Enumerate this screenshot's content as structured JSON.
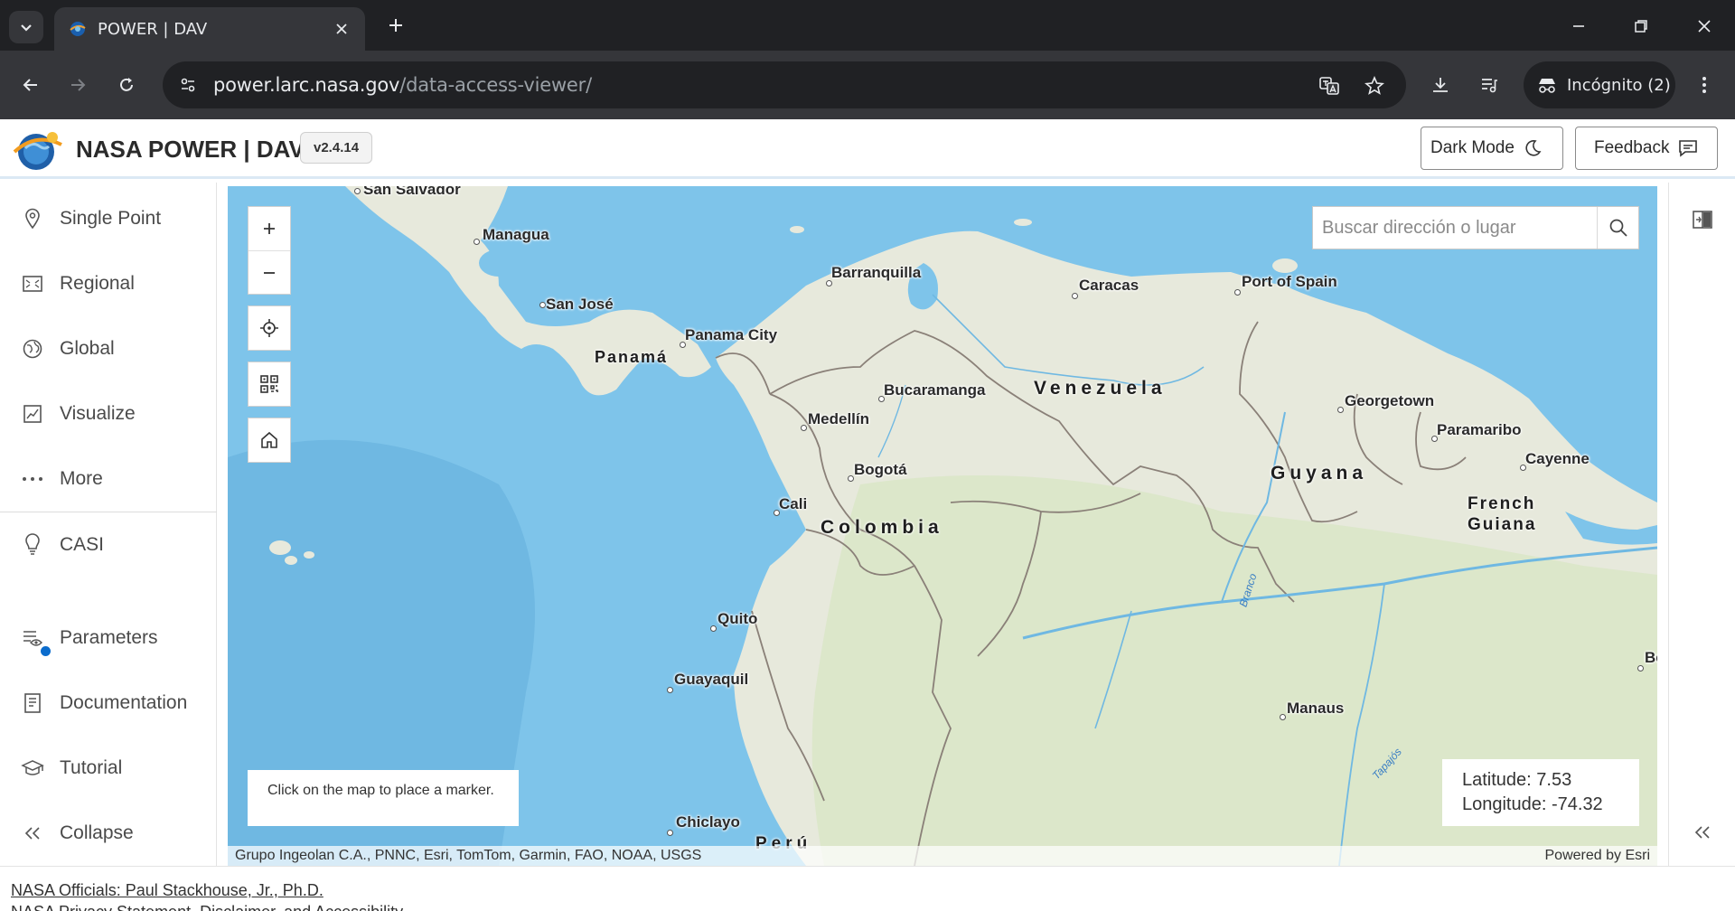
{
  "browser": {
    "tab_title": "POWER | DAV",
    "url_host": "power.larc.nasa.gov",
    "url_path": "/data-access-viewer/",
    "incognito_label": "Incógnito (2)"
  },
  "header": {
    "title": "NASA POWER | DAV",
    "version": "v2.4.14",
    "dark_mode_label": "Dark Mode",
    "feedback_label": "Feedback"
  },
  "sidebar": {
    "items": [
      {
        "label": "Single Point",
        "icon": "map-pin-icon"
      },
      {
        "label": "Regional",
        "icon": "region-icon"
      },
      {
        "label": "Global",
        "icon": "globe-icon"
      },
      {
        "label": "Visualize",
        "icon": "chart-icon"
      },
      {
        "label": "More",
        "icon": "ellipsis-icon"
      },
      {
        "label": "CASI",
        "icon": "lightbulb-icon"
      },
      {
        "label": "Parameters",
        "icon": "parameters-icon"
      },
      {
        "label": "Documentation",
        "icon": "document-icon"
      },
      {
        "label": "Tutorial",
        "icon": "graduation-cap-icon"
      },
      {
        "label": "Collapse",
        "icon": "double-chevron-left-icon"
      }
    ]
  },
  "map": {
    "search_placeholder": "Buscar dirección o lugar",
    "hint": "Click on the map to place a marker.",
    "latitude_label": "Latitude: 7.53",
    "longitude_label": "Longitude: -74.32",
    "attribution": "Grupo Ingeolan C.A., PNNC, Esri, TomTom, Garmin, FAO, NOAA, USGS",
    "powered_by": "Powered by Esri",
    "places": {
      "san_salvador": "San Salvador",
      "managua": "Managua",
      "san_jose": "San José",
      "panama_city": "Panama City",
      "barranquilla": "Barranquilla",
      "caracas": "Caracas",
      "port_of_spain": "Port of Spain",
      "bucaramanga": "Bucaramanga",
      "medellin": "Medellín",
      "bogota": "Bogotá",
      "cali": "Cali",
      "georgetown": "Georgetown",
      "paramaribo": "Paramaribo",
      "cayenne": "Cayenne",
      "quito": "Quito",
      "guayaquil": "Guayaquil",
      "manaus": "Manaus",
      "chiclayo": "Chiclayo",
      "be": "Be"
    },
    "countries": {
      "panama": "Panamá",
      "venezuela": "Venezuela",
      "colombia": "Colombia",
      "guyana": "Guyana",
      "french_guiana": "French Guiana",
      "peru": "Perú"
    },
    "rivers": {
      "branco": "Branco",
      "tapajos": "Tapajós"
    }
  },
  "footer": {
    "officials": "NASA Officials: Paul Stackhouse, Jr., Ph.D.",
    "privacy": "NASA Privacy Statement, Disclaimer, and Accessibility"
  },
  "colors": {
    "ocean": "#7ec4ea",
    "land": "#e7e9dc",
    "forest": "#d9e6c7",
    "border": "#8a8078",
    "chrome_dark": "#202124",
    "chrome_mid": "#35363a"
  }
}
